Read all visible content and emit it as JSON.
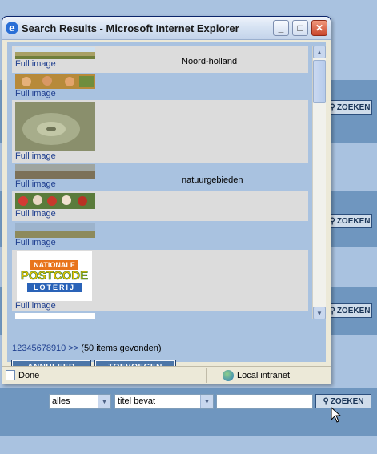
{
  "window": {
    "title": "Search Results - Microsoft Internet Explorer",
    "buttons": {
      "minimize": "_",
      "maximize": "□",
      "close": "✕"
    }
  },
  "results": [
    {
      "link": "Full image",
      "caption": "Noord-holland"
    },
    {
      "link": "Full image",
      "caption": ""
    },
    {
      "link": "Full image",
      "caption": ""
    },
    {
      "link": "Full image",
      "caption": "natuurgebieden"
    },
    {
      "link": "Full image",
      "caption": ""
    },
    {
      "link": "Full image",
      "caption": ""
    },
    {
      "link": "Full image",
      "caption": ""
    }
  ],
  "logo": {
    "line1": "NATIONALE",
    "line2": "POSTCODE",
    "line3": "LOTERIJ"
  },
  "pager": {
    "pages": "12345678910",
    "next": ">>",
    "count": "(50 items gevonden)"
  },
  "actions": {
    "cancel": "ANNULEER",
    "add": "TOEVOEGEN"
  },
  "status": {
    "text": "Done",
    "zone": "Local intranet"
  },
  "background": {
    "search_button": "ZOEKEN",
    "select1": "alles",
    "select2": "titel bevat"
  },
  "colors": {
    "band_dark": "#6f96bf",
    "band_light": "#a9c2e0",
    "button": "#4c76a8"
  }
}
